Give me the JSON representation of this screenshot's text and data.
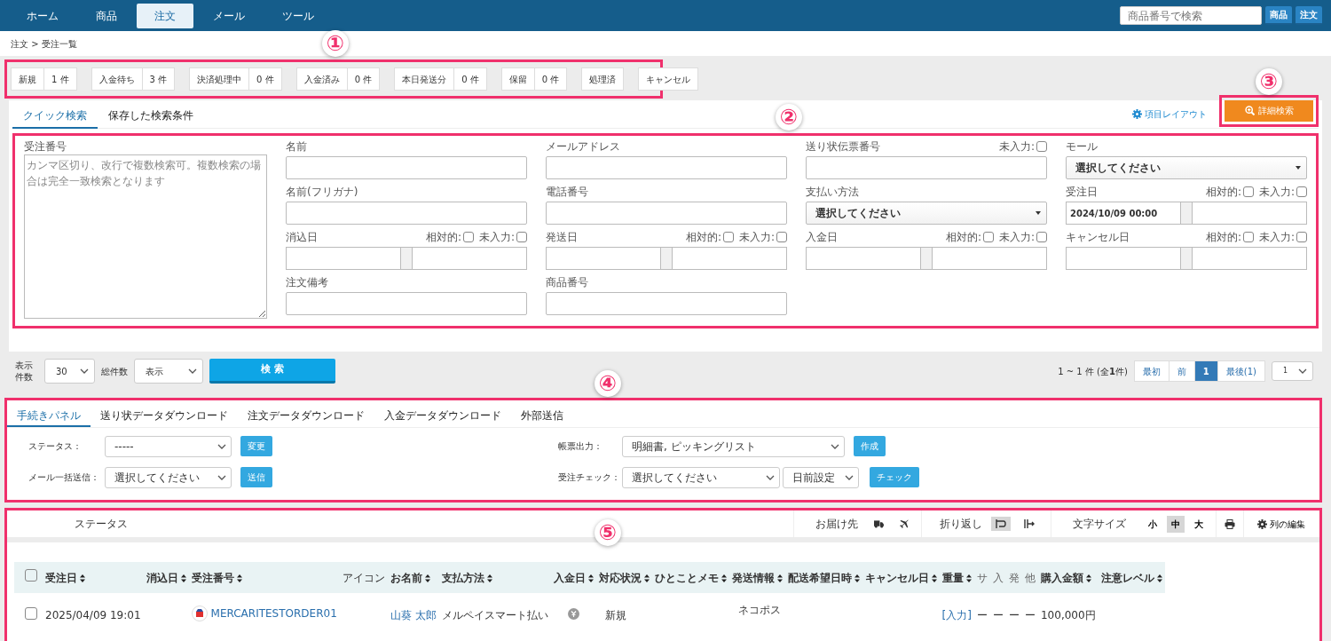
{
  "nav": {
    "tabs": [
      {
        "label": "ホーム",
        "selected": false
      },
      {
        "label": "商品",
        "selected": false
      },
      {
        "label": "注文",
        "selected": true
      },
      {
        "label": "メール",
        "selected": false
      },
      {
        "label": "ツール",
        "selected": false
      }
    ],
    "search": {
      "placeholder": "商品番号で検索"
    },
    "search_buttons": [
      "商品",
      "注文"
    ]
  },
  "breadcrumb": "注文 > 受注一覧",
  "status_steps": [
    {
      "label": "新規",
      "count": "1 件"
    },
    {
      "label": "入金待ち",
      "count": "3 件"
    },
    {
      "label": "決済処理中",
      "count": "0 件"
    },
    {
      "label": "入金済み",
      "count": "0 件"
    },
    {
      "label": "本日発送分",
      "count": "0 件"
    },
    {
      "label": "保留",
      "count": "0 件"
    },
    {
      "label": "処理済"
    },
    {
      "label": "キャンセル"
    }
  ],
  "search_tabs": [
    {
      "label": "クイック検索",
      "selected": true
    },
    {
      "label": "保存した検索条件",
      "selected": false
    }
  ],
  "layout_link": "項目レイアウト",
  "advanced_search_button": "詳細検索",
  "order_number_field": {
    "label": "受注番号",
    "placeholder": "カンマ区切り、改行で複数検索可。複数検索の場合は完全一致検索となります"
  },
  "fields": [
    {
      "kind": "text",
      "label": "名前"
    },
    {
      "kind": "text",
      "label": "メールアドレス"
    },
    {
      "kind": "text",
      "label": "送り状伝票番号",
      "checks": [
        {
          "label": "未入力:",
          "checked": false
        }
      ]
    },
    {
      "kind": "select",
      "label": "モール",
      "value": "選択してください"
    },
    {
      "kind": "text",
      "label": "名前(フリガナ)"
    },
    {
      "kind": "text",
      "label": "電話番号"
    },
    {
      "kind": "select",
      "label": "支払い方法",
      "value": "選択してください"
    },
    {
      "kind": "daterange",
      "label": "受注日",
      "value": "2024/10/09 00:00",
      "checks": [
        {
          "label": "相対的:",
          "checked": false
        },
        {
          "label": "未入力:",
          "checked": false
        }
      ]
    },
    {
      "kind": "daterange",
      "label": "消込日",
      "checks": [
        {
          "label": "相対的:",
          "checked": false
        },
        {
          "label": "未入力:",
          "checked": false
        }
      ]
    },
    {
      "kind": "daterange",
      "label": "発送日",
      "checks": [
        {
          "label": "相対的:",
          "checked": false
        },
        {
          "label": "未入力:",
          "checked": false
        }
      ]
    },
    {
      "kind": "daterange",
      "label": "入金日",
      "checks": [
        {
          "label": "相対的:",
          "checked": false
        },
        {
          "label": "未入力:",
          "checked": false
        }
      ]
    },
    {
      "kind": "daterange",
      "label": "キャンセル日",
      "checks": [
        {
          "label": "相対的:",
          "checked": false
        },
        {
          "label": "未入力:",
          "checked": false
        }
      ]
    },
    {
      "kind": "text",
      "label": "注文備考"
    },
    {
      "kind": "text",
      "label": "商品番号"
    }
  ],
  "result_bar": {
    "per_page_label": "表示件数",
    "per_page": "30",
    "total_label": "総件数",
    "total": "表示",
    "search_button": "検 索",
    "summary": "1 ~ 1 件 (全**1**件)",
    "pages": [
      {
        "label": "最初",
        "selected": false
      },
      {
        "label": "前",
        "selected": false
      },
      {
        "label": "1",
        "selected": true
      },
      {
        "label": "最後(1)",
        "selected": false
      }
    ],
    "page_select": "1"
  },
  "procedure": {
    "tabs": [
      {
        "label": "手続きパネル",
        "selected": true
      },
      {
        "label": "送り状データダウンロード",
        "selected": false
      },
      {
        "label": "注文データダウンロード",
        "selected": false
      },
      {
        "label": "入金データダウンロード",
        "selected": false
      },
      {
        "label": "外部送信",
        "selected": false
      }
    ],
    "left": [
      {
        "label": "ステータス：",
        "selects": [
          "-----"
        ],
        "button": "変更"
      },
      {
        "label": "メール一括送信：",
        "selects": [
          "選択してください"
        ],
        "button": "送信"
      }
    ],
    "right": [
      {
        "label": "帳票出力：",
        "selects": [
          "明細書, ピッキングリスト"
        ],
        "button": "作成"
      },
      {
        "label": "受注チェック：",
        "selects": [
          "選択してください",
          "日前設定"
        ],
        "button": "チェック"
      }
    ]
  },
  "toolbar": {
    "status_label": "ステータス",
    "delivery_label": "お届け先",
    "wrap_label": "折り返し",
    "wrap_modes": [
      {
        "selected": true
      },
      {
        "selected": false
      }
    ],
    "font_size_label": "文字サイズ",
    "font_sizes": [
      {
        "label": "小",
        "selected": false
      },
      {
        "label": "中",
        "selected": true
      },
      {
        "label": "大",
        "selected": false
      }
    ],
    "edit_columns": "列の編集"
  },
  "table": {
    "select_all": {
      "checked": false
    },
    "columns": [
      {
        "label": "受注日",
        "sortable": true
      },
      {
        "label": "消込日",
        "sortable": true
      },
      {
        "label": "受注番号",
        "sortable": true
      },
      {
        "label": "アイコン",
        "sortable": false
      },
      {
        "label": "お名前",
        "sortable": true
      },
      {
        "label": "支払方法",
        "sortable": true
      },
      {
        "label": "入金日",
        "sortable": true
      },
      {
        "label": "対応状況",
        "sortable": true
      },
      {
        "label": "ひとことメモ",
        "sortable": true
      },
      {
        "label": "発送情報",
        "sortable": true
      },
      {
        "label": "配送希望日時",
        "sortable": true
      },
      {
        "label": "キャンセル日",
        "sortable": true
      },
      {
        "label": "重量",
        "sortable": true
      },
      {
        "label": "サ",
        "sortable": false
      },
      {
        "label": "入",
        "sortable": false
      },
      {
        "label": "発",
        "sortable": false
      },
      {
        "label": "他",
        "sortable": false
      },
      {
        "label": "購入金額",
        "sortable": true
      },
      {
        "label": "注意レベル",
        "sortable": true
      }
    ],
    "rows": [
      {
        "checked": false,
        "order_date": "2025/04/09 19:01",
        "order_number": "MERCARITESTORDER01",
        "name": "山葵 太郎",
        "payment": "メルペイスマート払い",
        "status": "新規",
        "shipping": "ネコポス",
        "weight": "[入力]",
        "flags": [
          "ー",
          "ー",
          "ー",
          "ー"
        ],
        "amount": "100,000円"
      }
    ]
  },
  "annotations": [
    {
      "label": "①"
    },
    {
      "label": "②"
    },
    {
      "label": "③"
    },
    {
      "label": "④"
    },
    {
      "label": "⑤"
    }
  ]
}
